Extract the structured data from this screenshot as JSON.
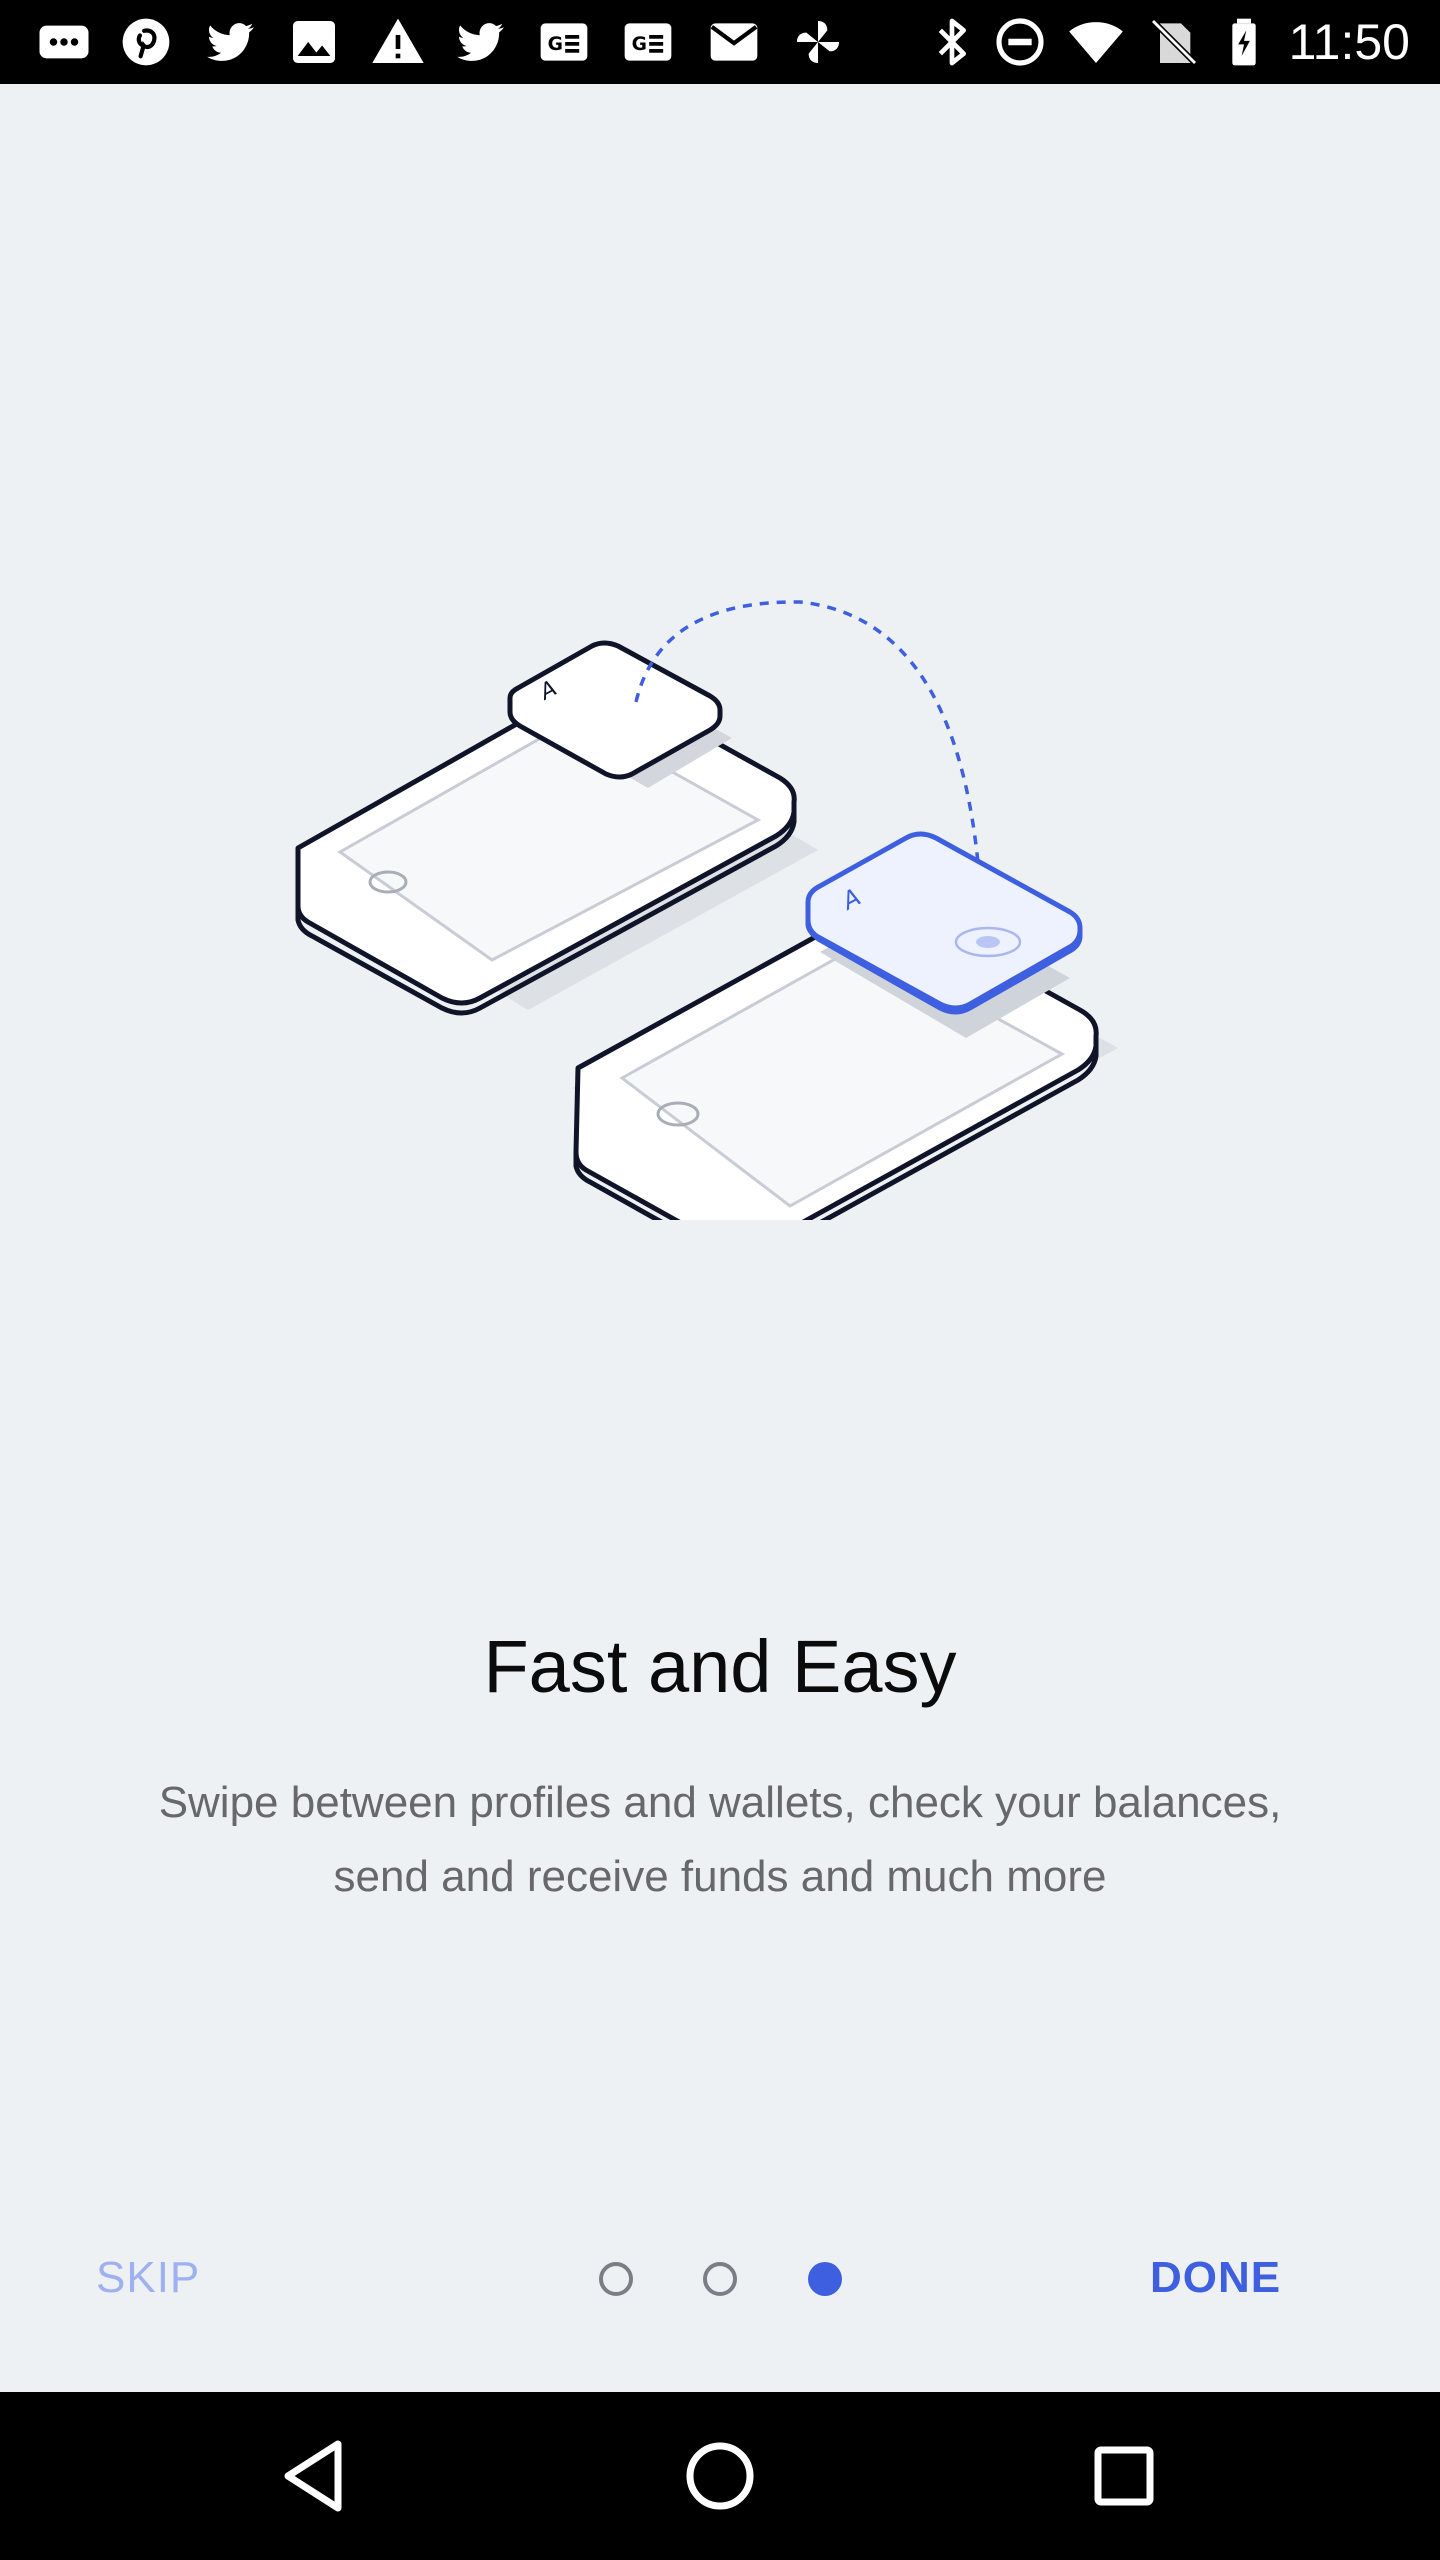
{
  "status_bar": {
    "time": "11:50",
    "left_icons": [
      "messaging-icon",
      "pinterest-icon",
      "twitter-icon",
      "image-icon",
      "warning-icon",
      "twitter-icon",
      "news-icon",
      "news-icon",
      "mail-icon",
      "pinwheel-icon"
    ],
    "right_icons": [
      "bluetooth-icon",
      "do-not-disturb-icon",
      "wifi-icon",
      "no-sim-icon",
      "battery-charging-icon"
    ]
  },
  "onboarding": {
    "title": "Fast and Easy",
    "description": "Swipe between profiles and wallets, check your balances, send and receive funds and much more",
    "illustration_card_letter": "A",
    "skip_label": "SKIP",
    "done_label": "DONE",
    "page_count": 3,
    "current_page": 3
  },
  "colors": {
    "background": "#edf1f4",
    "accent": "#3d5fe0",
    "skip_text": "#9fb0f0",
    "title_text": "#0b0b0b",
    "description_text": "#66686c"
  },
  "nav_bar": {
    "buttons": [
      "back-icon",
      "home-icon",
      "recents-icon"
    ]
  }
}
